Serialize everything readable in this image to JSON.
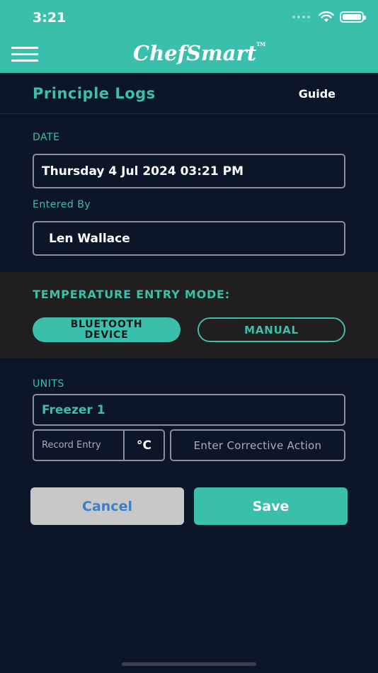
{
  "status_bar": {
    "time": "3:21"
  },
  "app": {
    "logo_text": "ChefSmart",
    "logo_tm": "TM"
  },
  "header": {
    "title": "Principle Logs",
    "guide_label": "Guide"
  },
  "form": {
    "date_label": "DATE",
    "date_value": "Thursday 4 Jul 2024 03:21 PM",
    "entered_by_label": "Entered By",
    "entered_by_value": "Len Wallace"
  },
  "mode": {
    "title": "TEMPERATURE ENTRY MODE:",
    "options": [
      {
        "label_line1": "BLUETOOTH",
        "label_line2": "DEVICE",
        "selected": true
      },
      {
        "label": "MANUAL",
        "selected": false
      }
    ]
  },
  "units": {
    "label": "UNITS",
    "selected": "Freezer 1",
    "record_placeholder": "Record Entry",
    "unit_symbol": "°C",
    "corrective_placeholder": "Enter Corrective Action"
  },
  "actions": {
    "cancel": "Cancel",
    "save": "Save"
  },
  "colors": {
    "accent": "#3bbfad",
    "background": "#0d1628",
    "mode_bg": "#211e1f",
    "cancel_bg": "#c8c8c8",
    "cancel_text": "#3c7fc4"
  }
}
